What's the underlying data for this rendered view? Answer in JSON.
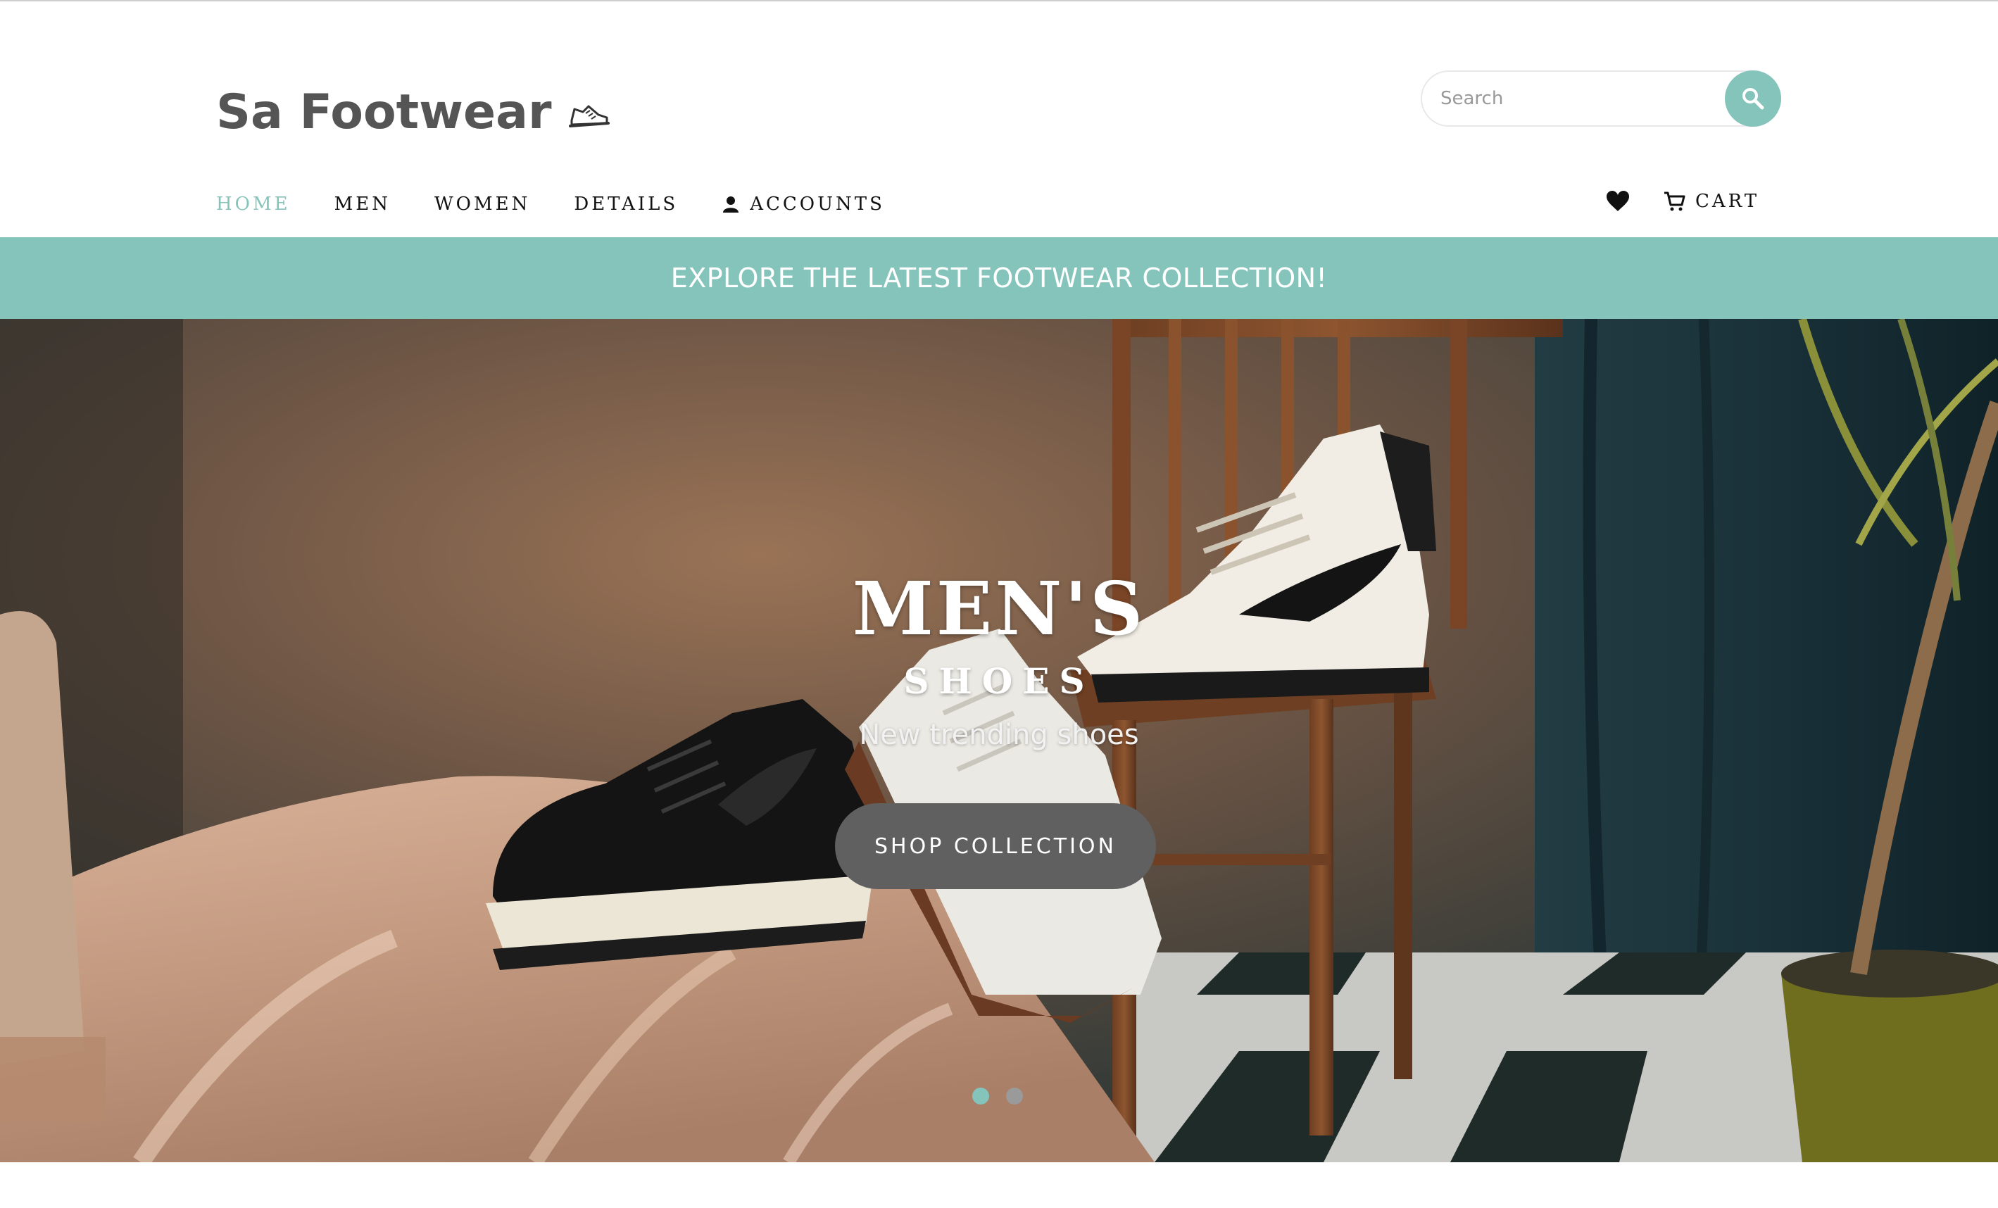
{
  "brand": {
    "name": "Sa Footwear",
    "logo_icon": "sneaker-icon"
  },
  "search": {
    "placeholder": "Search",
    "value": "",
    "button_icon": "search-icon"
  },
  "nav": {
    "items": [
      {
        "label": "HOME",
        "active": true
      },
      {
        "label": "MEN",
        "active": false
      },
      {
        "label": "WOMEN",
        "active": false
      },
      {
        "label": "DETAILS",
        "active": false
      },
      {
        "label": "ACCOUNTS",
        "active": false,
        "icon": "user-icon"
      }
    ],
    "right": {
      "wishlist_icon": "heart-icon",
      "cart_icon": "cart-icon",
      "cart_label": "CART"
    }
  },
  "banner": {
    "text": "EXPLORE THE LATEST FOOTWEAR COLLECTION!"
  },
  "hero": {
    "title": "MEN'S",
    "subtitle": "SHOES",
    "tagline": "New trending shoes",
    "cta_label": "SHOP COLLECTION",
    "slides": {
      "count": 2,
      "active_index": 0
    }
  },
  "colors": {
    "accent": "#85c4bb",
    "text_dark": "#111111",
    "logo_gray": "#555555",
    "cta_bg": "#606060",
    "dot_inactive": "#9a9a9a"
  }
}
